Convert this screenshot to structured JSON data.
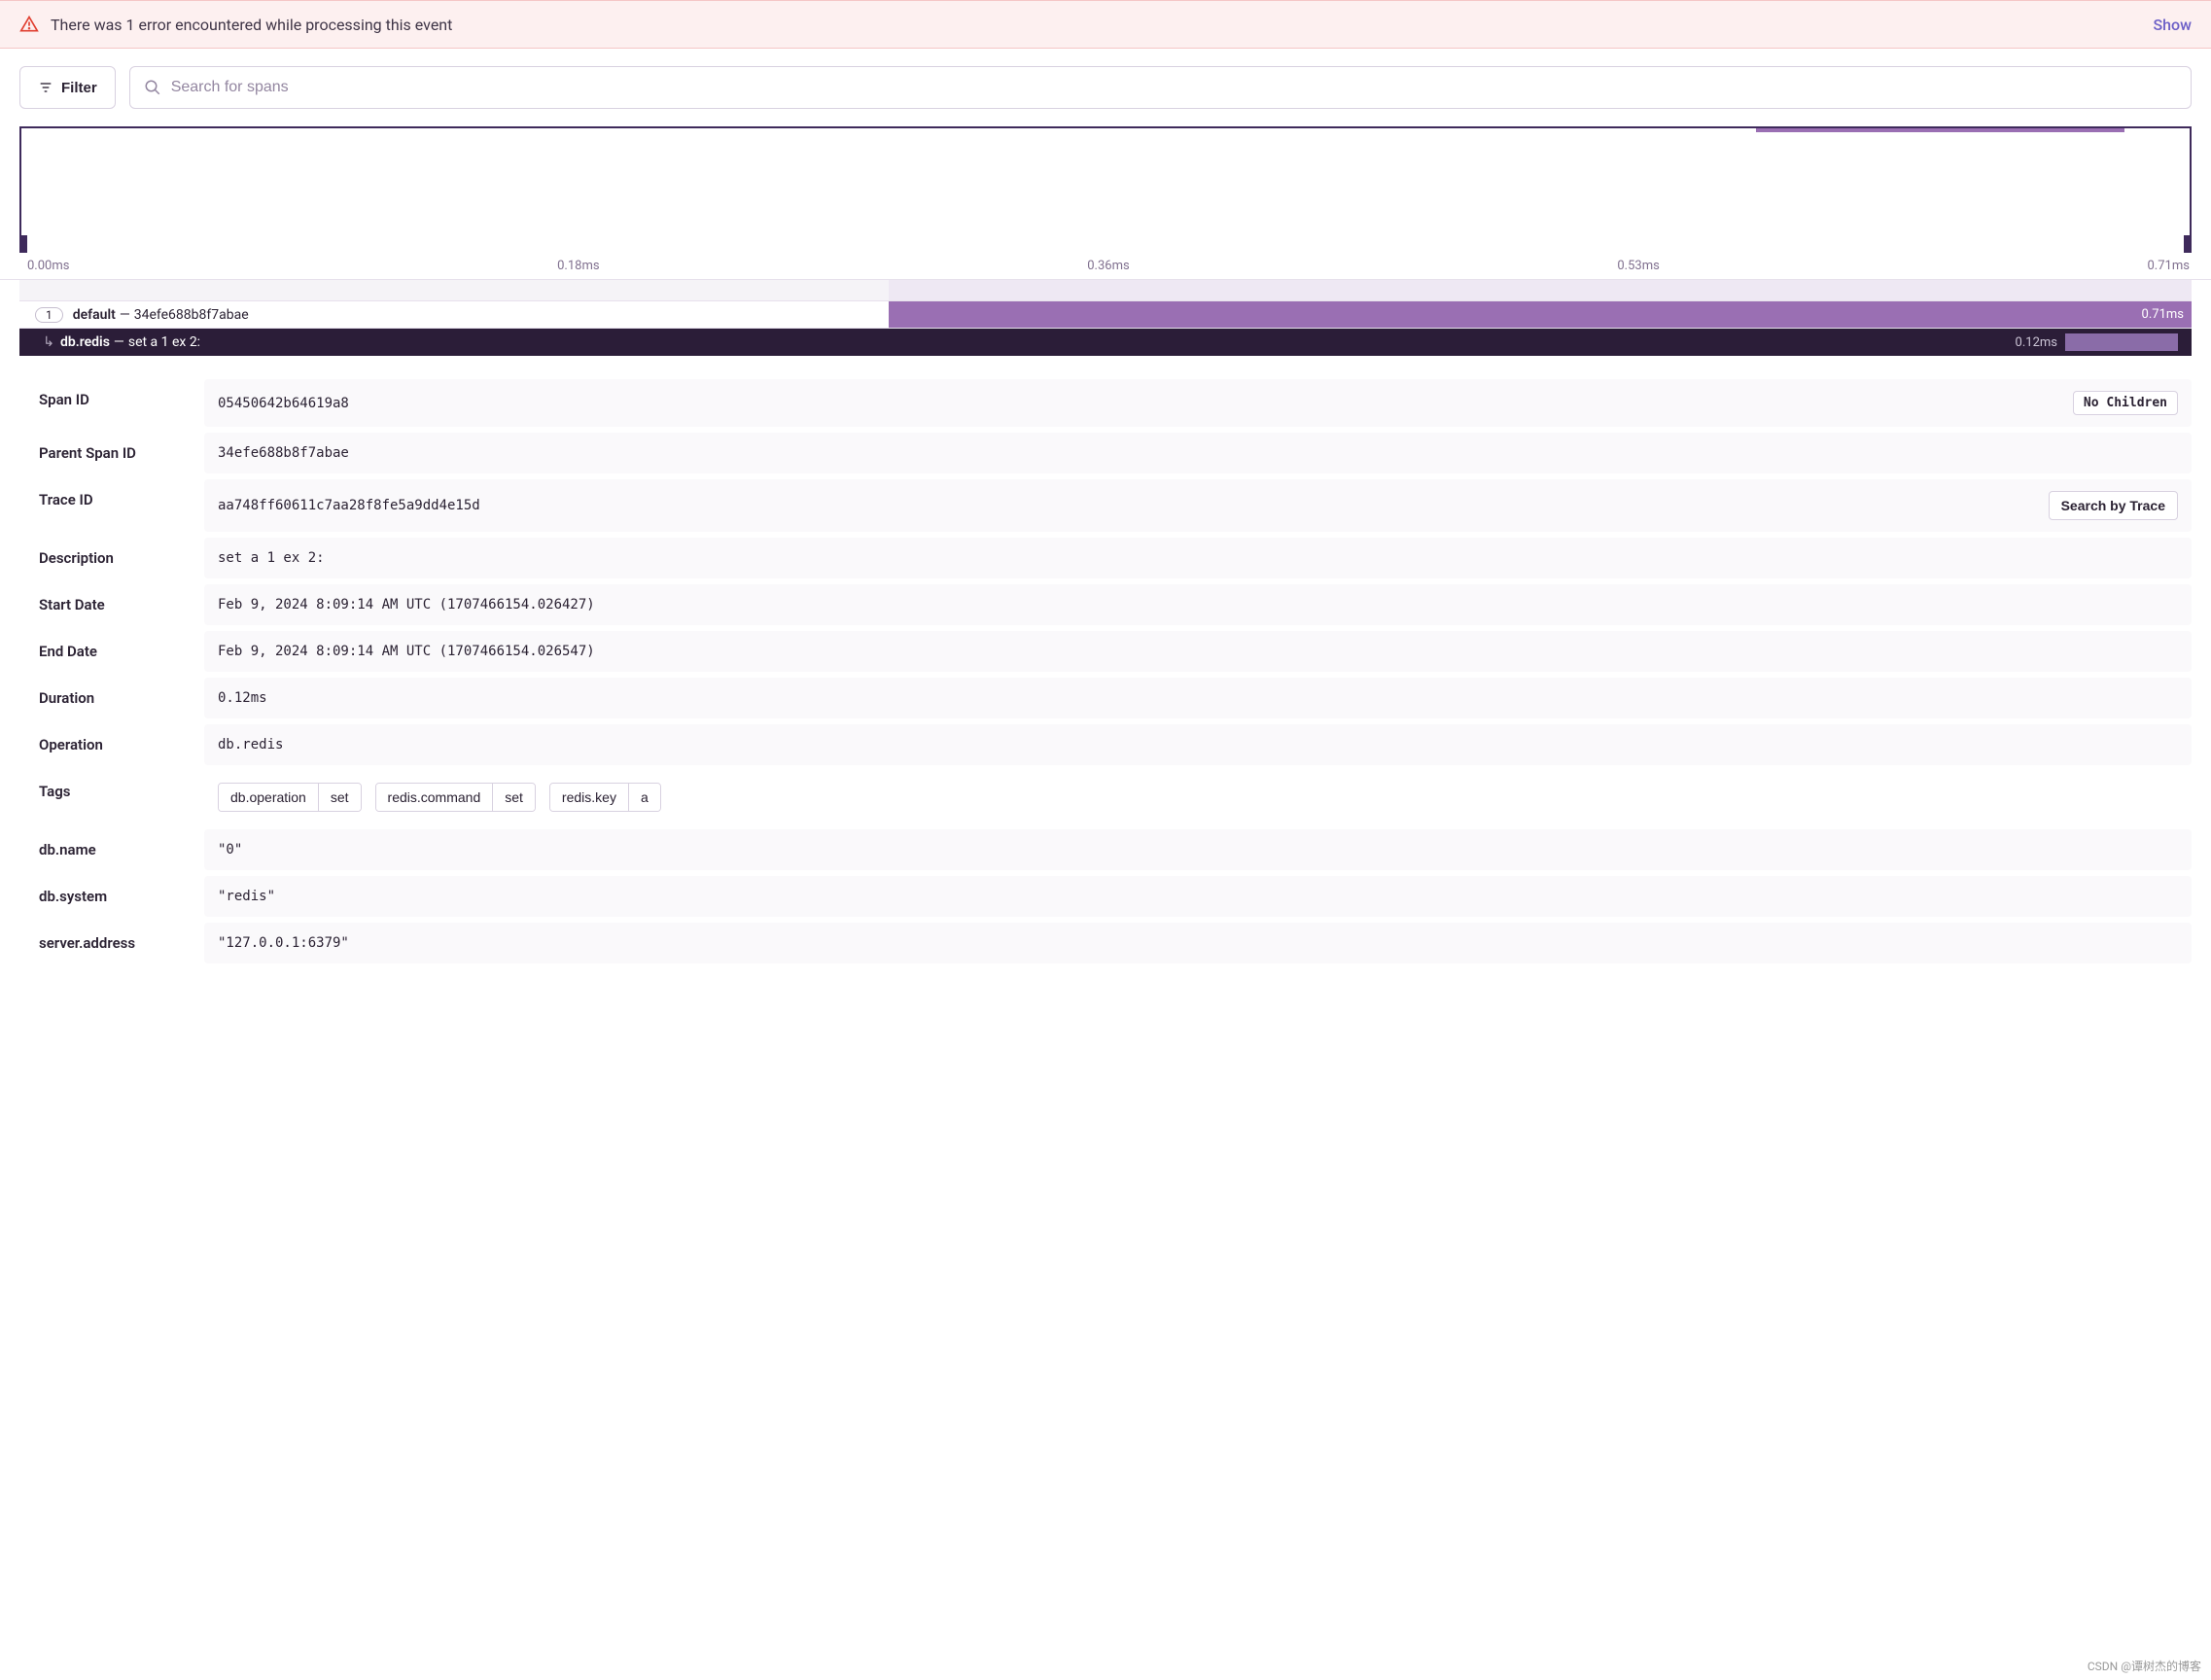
{
  "error_banner": {
    "message": "There was 1 error encountered while processing this event",
    "action": "Show"
  },
  "toolbar": {
    "filter_label": "Filter",
    "search_placeholder": "Search for spans"
  },
  "axis": {
    "ticks": [
      "0.00ms",
      "0.18ms",
      "0.36ms",
      "0.53ms",
      "0.71ms"
    ]
  },
  "spans": {
    "root": {
      "count": "1",
      "op": "default",
      "id": "34efe688b8f7abae",
      "duration": "0.71ms"
    },
    "child": {
      "op": "db.redis",
      "desc": "set a 1 ex 2:",
      "duration": "0.12ms"
    }
  },
  "details": {
    "span_id": {
      "label": "Span ID",
      "value": "05450642b64619a8",
      "badge": "No Children"
    },
    "parent_span_id": {
      "label": "Parent Span ID",
      "value": "34efe688b8f7abae"
    },
    "trace_id": {
      "label": "Trace ID",
      "value": "aa748ff60611c7aa28f8fe5a9dd4e15d",
      "action": "Search by Trace"
    },
    "description": {
      "label": "Description",
      "value": "set a 1 ex 2:"
    },
    "start_date": {
      "label": "Start Date",
      "value": "Feb 9, 2024 8:09:14 AM UTC (1707466154.026427)"
    },
    "end_date": {
      "label": "End Date",
      "value": "Feb 9, 2024 8:09:14 AM UTC (1707466154.026547)"
    },
    "duration": {
      "label": "Duration",
      "value": "0.12ms"
    },
    "operation": {
      "label": "Operation",
      "value": "db.redis"
    },
    "tags": {
      "label": "Tags",
      "items": [
        {
          "k": "db.operation",
          "v": "set"
        },
        {
          "k": "redis.command",
          "v": "set"
        },
        {
          "k": "redis.key",
          "v": "a"
        }
      ]
    },
    "db_name": {
      "label": "db.name",
      "value": "\"0\""
    },
    "db_system": {
      "label": "db.system",
      "value": "\"redis\""
    },
    "server_address": {
      "label": "server.address",
      "value": "\"127.0.0.1:6379\""
    }
  },
  "watermark": "CSDN @谭树杰的博客"
}
